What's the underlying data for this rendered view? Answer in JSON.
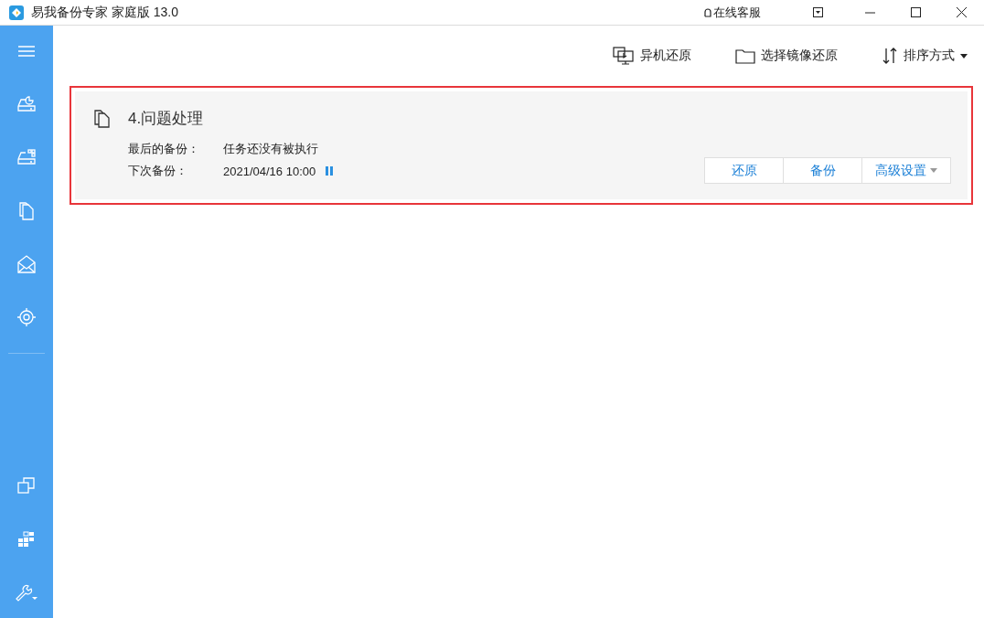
{
  "window": {
    "title": "易我备份专家 家庭版 13.0",
    "support": "在线客服"
  },
  "toolbar": {
    "actions": [
      {
        "kind": "remote",
        "label": "异机还原"
      },
      {
        "kind": "image",
        "label": "选择镜像还原"
      },
      {
        "kind": "sort",
        "label": "排序方式"
      }
    ]
  },
  "task": {
    "name": "4.问题处理",
    "highlighted": true,
    "fields": [
      {
        "label": "最后的备份：",
        "value": "任务还没有被执行",
        "paused": false
      },
      {
        "label": "下次备份：",
        "value": "2021/04/16 10:00",
        "paused": true
      }
    ],
    "buttons": [
      {
        "label": "还原",
        "menu": false
      },
      {
        "label": "备份",
        "menu": false
      },
      {
        "label": "高级设置",
        "menu": true
      }
    ]
  }
}
